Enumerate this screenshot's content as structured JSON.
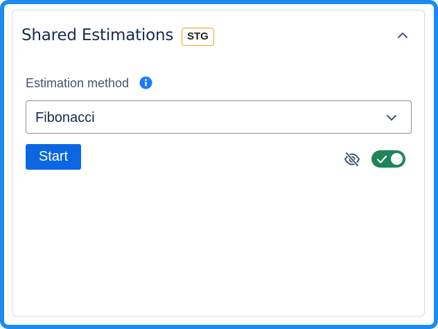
{
  "panel": {
    "title": "Shared Estimations",
    "env_badge": "STG",
    "collapse_icon": "chevron-up-icon"
  },
  "estimation": {
    "label": "Estimation method",
    "info_icon": "info-icon",
    "selected_value": "Fibonacci",
    "dropdown_icon": "chevron-down-icon"
  },
  "actions": {
    "start_label": "Start",
    "visibility_icon": "eye-off-icon",
    "toggle": {
      "checked": true
    }
  },
  "colors": {
    "frame_border": "#1a8cf0",
    "badge_border": "#f0a21a",
    "primary_button": "#0c66e4",
    "info_icon": "#1d7afc",
    "toggle_on": "#1f845a"
  }
}
